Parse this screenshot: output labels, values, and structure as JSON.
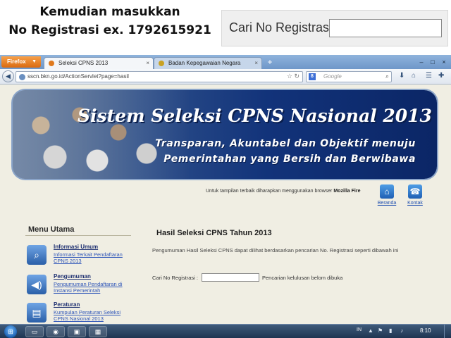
{
  "annotation": {
    "line1": "Kemudian masukkan",
    "line2": "No Registrasi ex. 1792615921",
    "zoom_label": "Cari No Registrasi :",
    "zoom_value": ""
  },
  "browser": {
    "app_button": "Firefox",
    "tabs": [
      {
        "label": "Seleksi CPNS 2013",
        "active": true
      },
      {
        "label": "Badan Kepegawaian Negara",
        "active": false
      }
    ],
    "new_tab": "+",
    "url": "sscn.bkn.go.id/ActionServlet?page=hasil",
    "search_engine": "8",
    "search_placeholder": "Google"
  },
  "page": {
    "banner": {
      "title": "Sistem Seleksi CPNS Nasional 2013",
      "tagline1": "Transparan, Akuntabel dan Objektif menuju",
      "tagline2": "Pemerintahan yang Bersih dan Berwibawa"
    },
    "browser_note": "Untuk tampilan terbaik diharapkan menggunakan browser",
    "browser_note_bold": "Mozilla Fire",
    "shortcuts": [
      {
        "label": "Beranda",
        "icon": "home-icon"
      },
      {
        "label": "Kontak",
        "icon": "phone-icon"
      }
    ],
    "menu": {
      "title": "Menu Utama",
      "items": [
        {
          "heading": "Informasi Umum",
          "link": "Informasi Terkait Pendaftaran CPNS 2013",
          "icon": "search-icon"
        },
        {
          "heading": "Pengumuman",
          "link": "Pengumuman Pendaftaran di Instansi Pemerintah",
          "icon": "speaker-icon"
        },
        {
          "heading": "Peraturan",
          "link": "Kumpulan Peraturan Seleksi CPNS Nasional 2013",
          "icon": "document-icon"
        }
      ]
    },
    "content": {
      "title": "Hasil Seleksi CPNS Tahun 2013",
      "description": "Pengumuman Hasil Seleksi CPNS dapat dilihat berdasarkan pencarian No. Registrasi seperti dibawah ini",
      "search_label": "Cari No Registrasi :",
      "search_value": "",
      "search_note": "Pencarian kelulusan belom dibuka"
    }
  },
  "taskbar": {
    "lang": "IN",
    "clock": "8:10"
  },
  "colors": {
    "page_bg": "#f0eee3",
    "banner_dark": "#0b2666",
    "link": "#2e55b8",
    "firefox_orange": "#e8801e"
  }
}
